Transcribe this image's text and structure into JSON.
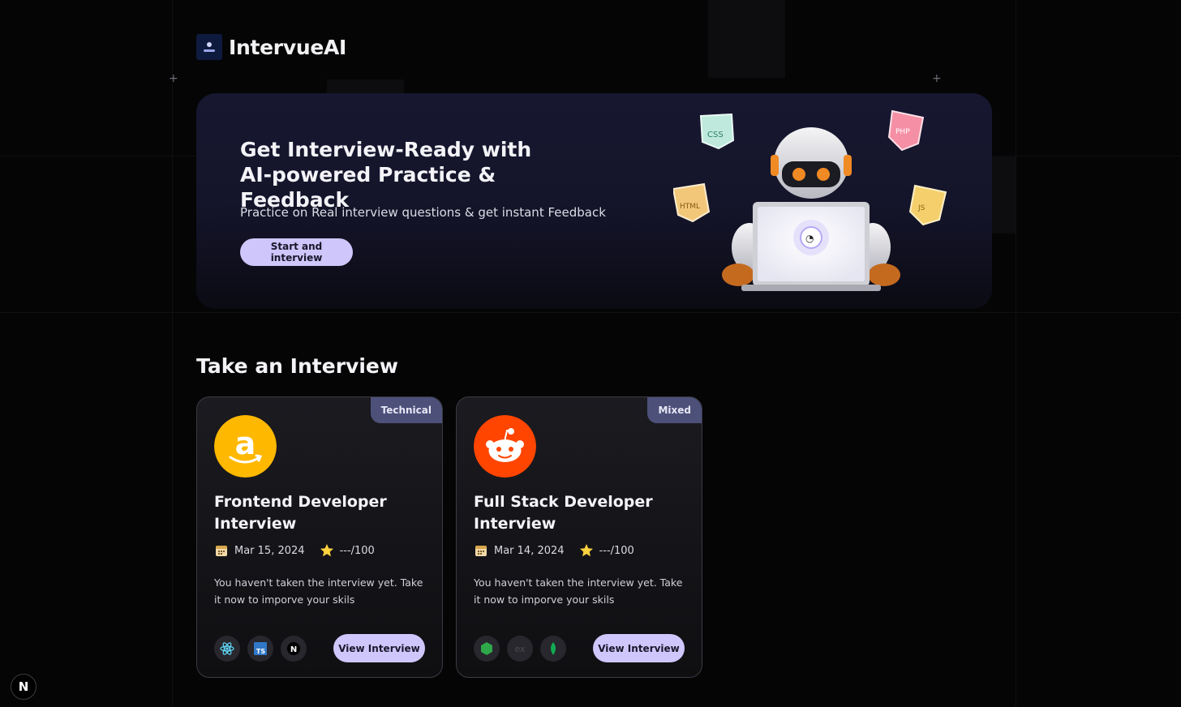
{
  "app": {
    "name": "IntervueAI"
  },
  "hero": {
    "title": "Get Interview-Ready with AI-powered Practice & Feedback",
    "subtitle": "Practice on Real interview questions & get instant Feedback",
    "cta_label": "Start and interview",
    "floating_tags": [
      "CSS",
      "PHP",
      "HTML",
      "JS"
    ]
  },
  "section": {
    "title": "Take an Interview"
  },
  "cards": [
    {
      "badge": "Technical",
      "logo": "amazon-logo",
      "title": "Frontend Developer Interview",
      "date": "Mar 15, 2024",
      "score": "---/100",
      "description": "You haven't taken the interview yet. Take it now to imporve your skils",
      "tech": [
        "react-icon",
        "typescript-icon",
        "nextjs-icon"
      ],
      "button_label": "View Interview"
    },
    {
      "badge": "Mixed",
      "logo": "reddit-logo",
      "title": "Full Stack Developer Interview",
      "date": "Mar 14, 2024",
      "score": "---/100",
      "description": "You haven't taken the interview yet. Take it now to imporve your skils",
      "tech": [
        "nodejs-icon",
        "express-icon",
        "mongodb-icon"
      ],
      "button_label": "View Interview"
    }
  ],
  "colors": {
    "background": "#050505",
    "accent": "#cfc6fb",
    "badge": "#4d5079",
    "amazon": "#ffb800",
    "reddit": "#ff4500"
  }
}
